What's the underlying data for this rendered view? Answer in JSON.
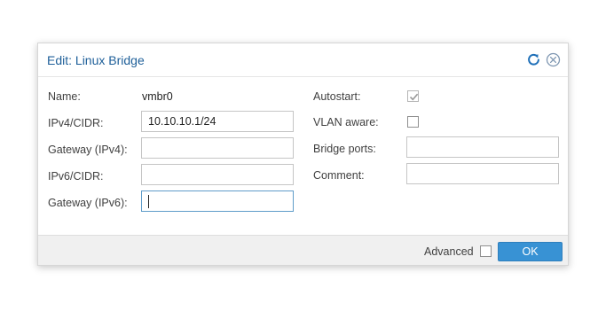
{
  "dialog": {
    "title": "Edit: Linux Bridge",
    "tools": {
      "refresh_icon": "refresh-icon",
      "close_icon": "close-circle-icon"
    }
  },
  "form": {
    "name": {
      "label": "Name:",
      "value": "vmbr0"
    },
    "ipv4_cidr": {
      "label": "IPv4/CIDR:",
      "value": "10.10.10.1/24"
    },
    "gateway_ipv4": {
      "label": "Gateway (IPv4):",
      "value": ""
    },
    "ipv6_cidr": {
      "label": "IPv6/CIDR:",
      "value": ""
    },
    "gateway_ipv6": {
      "label": "Gateway (IPv6):",
      "value": ""
    },
    "autostart": {
      "label": "Autostart:",
      "checked": true
    },
    "vlan_aware": {
      "label": "VLAN aware:",
      "checked": false
    },
    "bridge_ports": {
      "label": "Bridge ports:",
      "value": ""
    },
    "comment": {
      "label": "Comment:",
      "value": ""
    }
  },
  "footer": {
    "advanced_label": "Advanced",
    "advanced_checked": false,
    "ok_label": "OK"
  },
  "colors": {
    "title": "#1e5f99",
    "primary_button": "#3892d4",
    "focus_border": "#5f9cc9"
  }
}
